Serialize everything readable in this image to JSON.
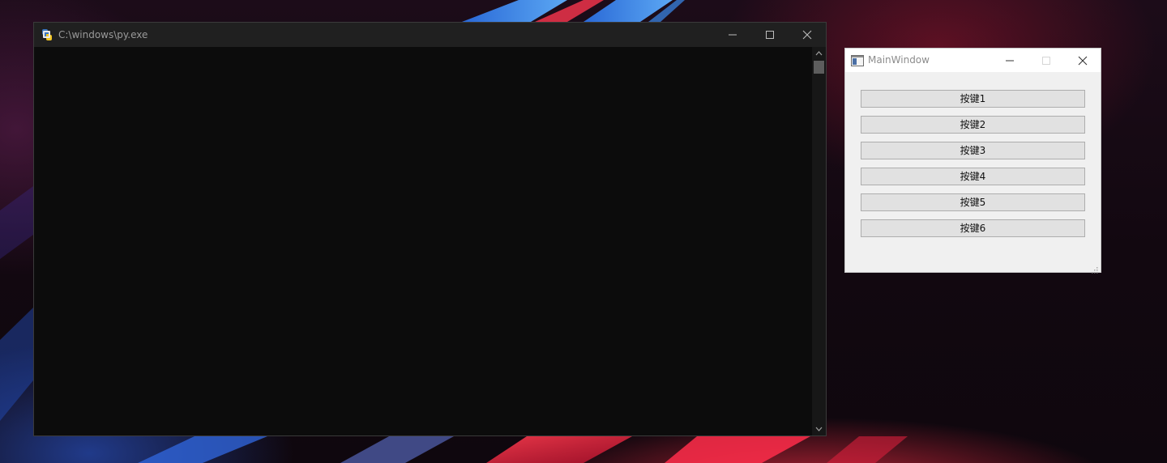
{
  "console_window": {
    "title": "C:\\windows\\py.exe",
    "controls": {
      "minimize_icon": "minimize-icon",
      "maximize_icon": "maximize-icon",
      "close_icon": "close-icon"
    },
    "background_color": "#0c0c0c"
  },
  "main_window": {
    "title": "MainWindow",
    "buttons": [
      {
        "label": "按键1"
      },
      {
        "label": "按键2"
      },
      {
        "label": "按键3"
      },
      {
        "label": "按键4"
      },
      {
        "label": "按键5"
      },
      {
        "label": "按键6"
      }
    ],
    "controls": {
      "minimize_icon": "minimize-icon",
      "maximize_icon": "maximize-icon",
      "close_icon": "close-icon"
    }
  },
  "colors": {
    "console_titlebar": "#202020",
    "main_window_bg": "#f0f0f0",
    "button_bg": "#e1e1e1",
    "button_border": "#adadad"
  }
}
